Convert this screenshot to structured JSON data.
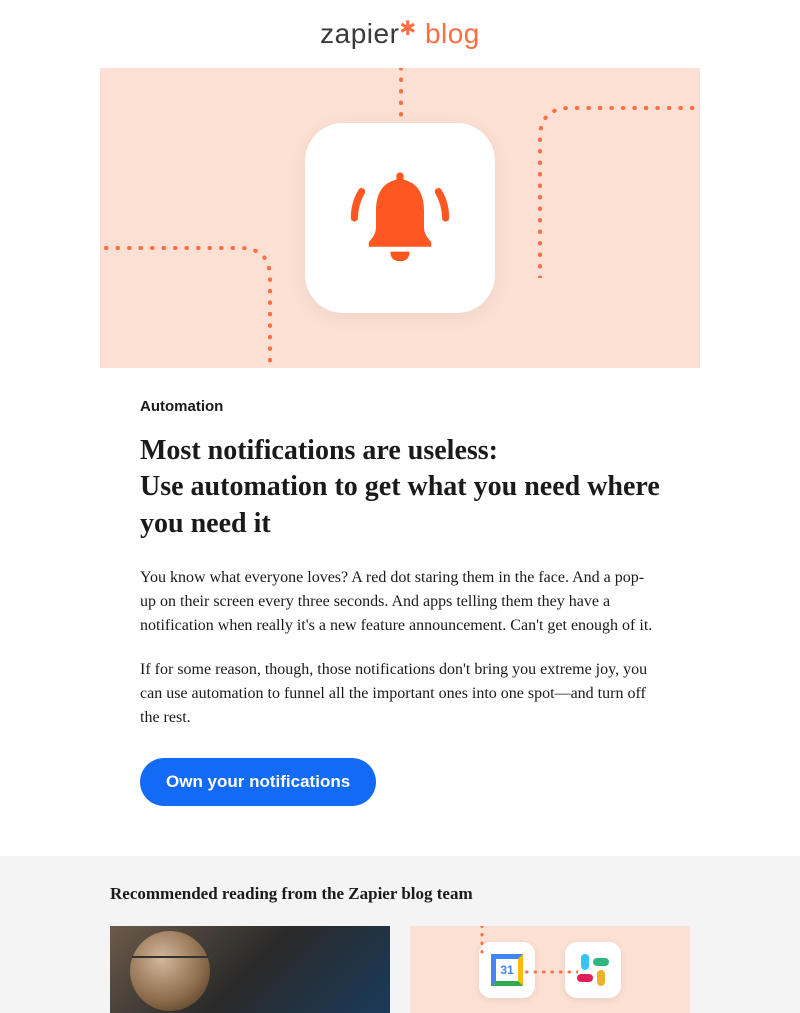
{
  "header": {
    "logo_brand": "zapier",
    "logo_suffix": "blog"
  },
  "hero": {
    "icon_name": "bell-icon"
  },
  "article": {
    "category": "Automation",
    "title_line1": "Most notifications are useless:",
    "title_line2": "Use automation to get what you need where you need it",
    "paragraph1": "You know what everyone loves? A red dot staring them in the face. And a pop-up on their screen every three seconds. And apps telling them they have a notification when really it's a new feature announcement. Can't get enough of it.",
    "paragraph2": "If for some reason, though, those notifications don't bring you extreme joy, you can use automation to funnel all the important ones into one spot—and turn off the rest.",
    "cta_label": "Own your notifications"
  },
  "recommended": {
    "heading": "Recommended reading from the Zapier blog team",
    "cards": [
      {
        "type": "photo"
      },
      {
        "type": "illustration",
        "calendar_day": "31"
      }
    ]
  },
  "colors": {
    "accent": "#ff6d42",
    "button": "#136bf5",
    "hero_bg": "#fce0d3"
  }
}
